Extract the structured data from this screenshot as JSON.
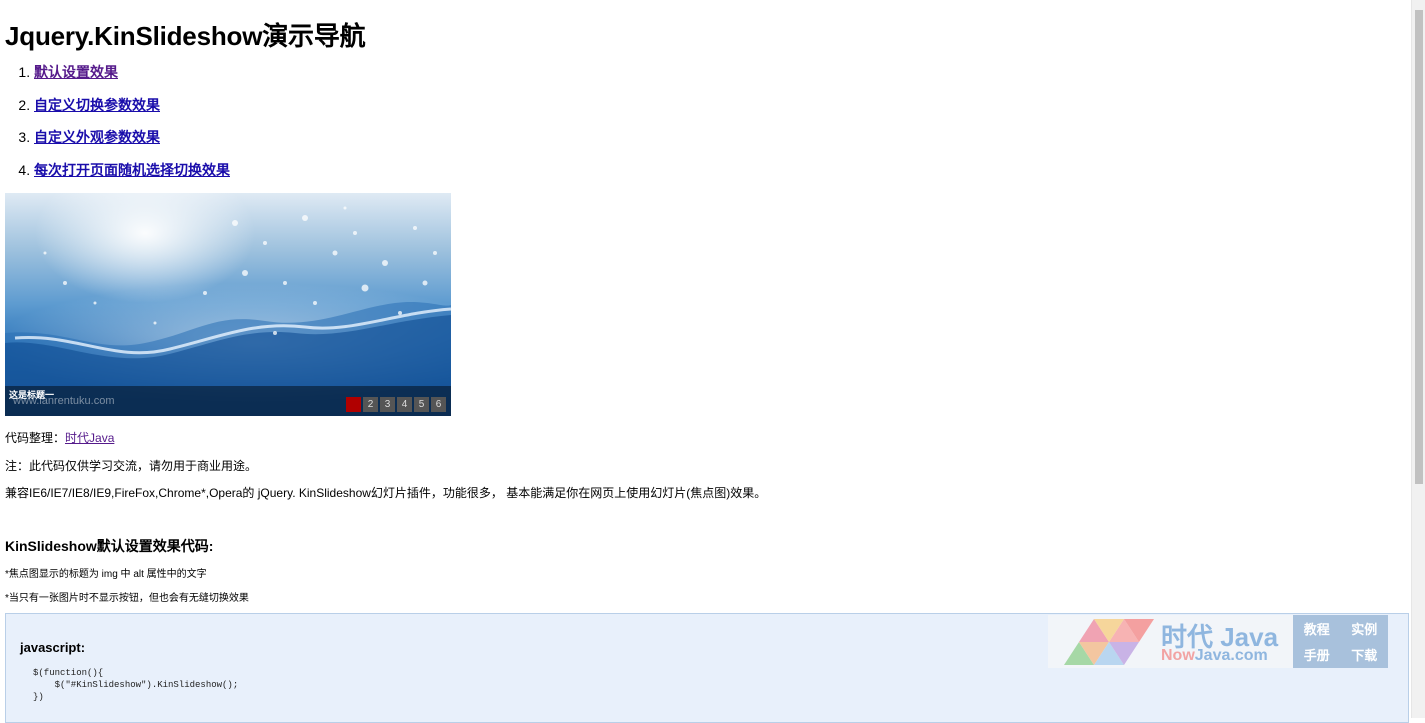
{
  "page": {
    "title": "Jquery.KinSlideshow演示导航"
  },
  "nav": {
    "items": [
      {
        "number": "1.",
        "label": "默认设置效果"
      },
      {
        "number": "2.",
        "label": "自定义切换参数效果"
      },
      {
        "number": "3.",
        "label": "自定义外观参数效果"
      },
      {
        "number": "4.",
        "label": "每次打开页面随机选择切换效果"
      }
    ]
  },
  "slideshow": {
    "caption": "这是标题一",
    "watermark": "www.lanrentuku.com",
    "buttons": [
      "1",
      "2",
      "3",
      "4",
      "5",
      "6"
    ],
    "active_index": 0,
    "active_color": "#b00000"
  },
  "info": {
    "credit_label": "代码整理：",
    "credit_link": "时代Java",
    "note": "注：此代码仅供学习交流，请勿用于商业用途。",
    "compat": "兼容IE6/IE7/IE8/IE9,FireFox,Chrome*,Opera的 jQuery. KinSlideshow幻灯片插件，功能很多， 基本能满足你在网页上使用幻灯片(焦点图)效果。"
  },
  "section": {
    "heading": "KinSlideshow默认设置效果代码:",
    "bullet1": "*焦点图显示的标题为 img 中 alt 属性中的文字",
    "bullet2": "*当只有一张图片时不显示按钮，但也会有无缝切换效果",
    "code_label": "javascript:",
    "code_line1": "$(function(){",
    "code_line2": "    $(\"#KinSlideshow\").KinSlideshow();",
    "code_line3": "})"
  },
  "brand": {
    "name": "时代 Java",
    "url_prefix": "Now",
    "url_rest": "Java.com",
    "links": [
      "教程",
      "实例",
      "手册",
      "下载"
    ]
  }
}
